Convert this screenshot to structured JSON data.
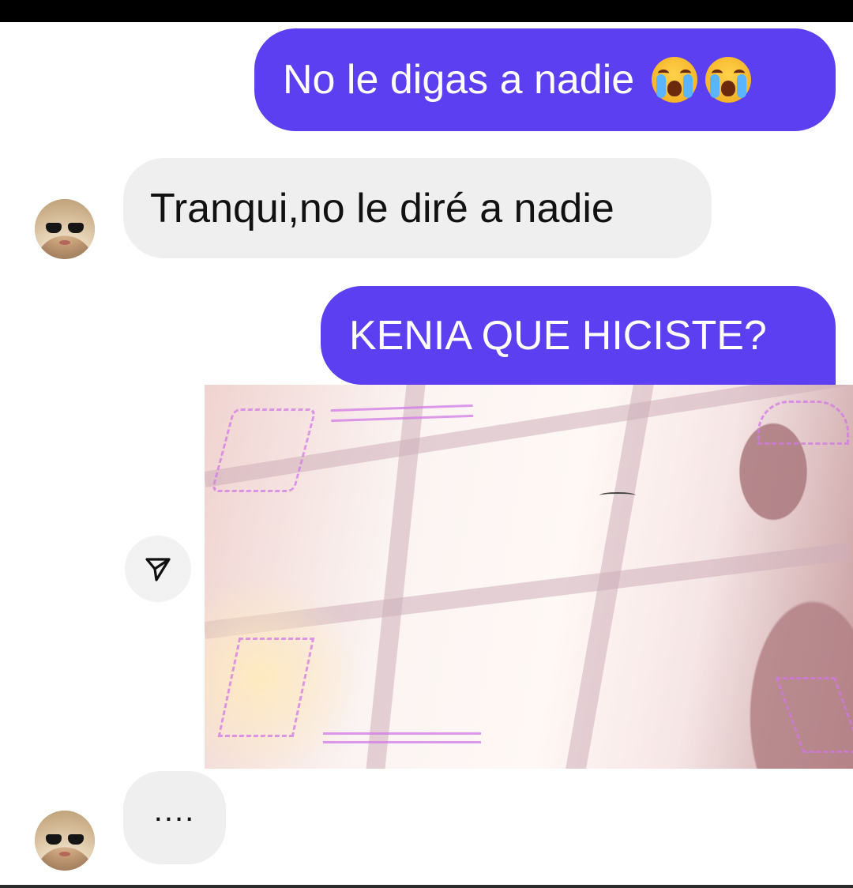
{
  "messages": [
    {
      "id": "msg1",
      "direction": "sent",
      "text": "No le digas a nadie",
      "emoji": [
        "loudly-crying-face",
        "loudly-crying-face"
      ]
    },
    {
      "id": "msg2",
      "direction": "received",
      "text": "Tranqui,no le diré a nadie"
    },
    {
      "id": "msg3",
      "direction": "sent",
      "text": "KENIA QUE HICISTE?"
    },
    {
      "id": "photo",
      "direction": "received",
      "type": "image",
      "description_icon": "shared-photo"
    },
    {
      "id": "msg4",
      "direction": "received",
      "text": "...."
    }
  ],
  "colors": {
    "sent_bubble": "#5b3ff1",
    "received_bubble": "#efefef",
    "sent_text": "#ffffff",
    "received_text": "#111111"
  },
  "icons": {
    "share": "send-paper-plane-icon",
    "avatar": "contact-avatar"
  }
}
